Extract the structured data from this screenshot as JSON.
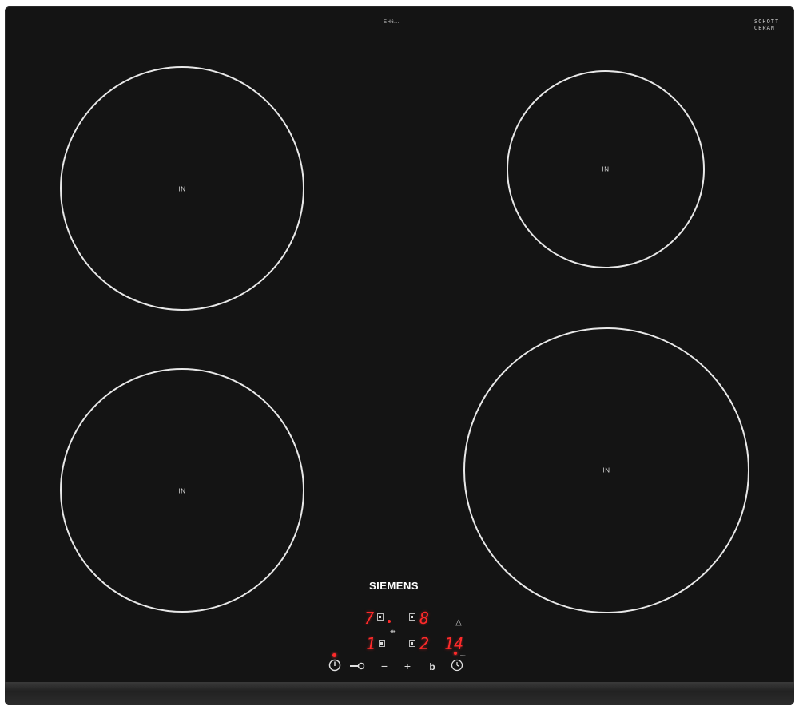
{
  "panel": {
    "model_code": "EH6...",
    "glass_brand": "SCHOTT\nCERAN",
    "glass_sub": "...",
    "brand": "SIEMENS"
  },
  "zones": [
    {
      "label": "IN"
    },
    {
      "label": "IN"
    },
    {
      "label": "IN"
    },
    {
      "label": "IN"
    }
  ],
  "displays": {
    "rear_left": "7",
    "rear_right": "8",
    "front_left": "1",
    "front_right": "2",
    "timer": "14",
    "timer_unit": "min"
  },
  "controls": {
    "power": "power-icon",
    "lock": "key-lock-icon",
    "minus": "−",
    "plus": "+",
    "boost": "b",
    "timer": "timer-icon"
  },
  "colors": {
    "glass": "#141414",
    "ring": "#e8e8e8",
    "display_red": "#ff2a2a"
  }
}
